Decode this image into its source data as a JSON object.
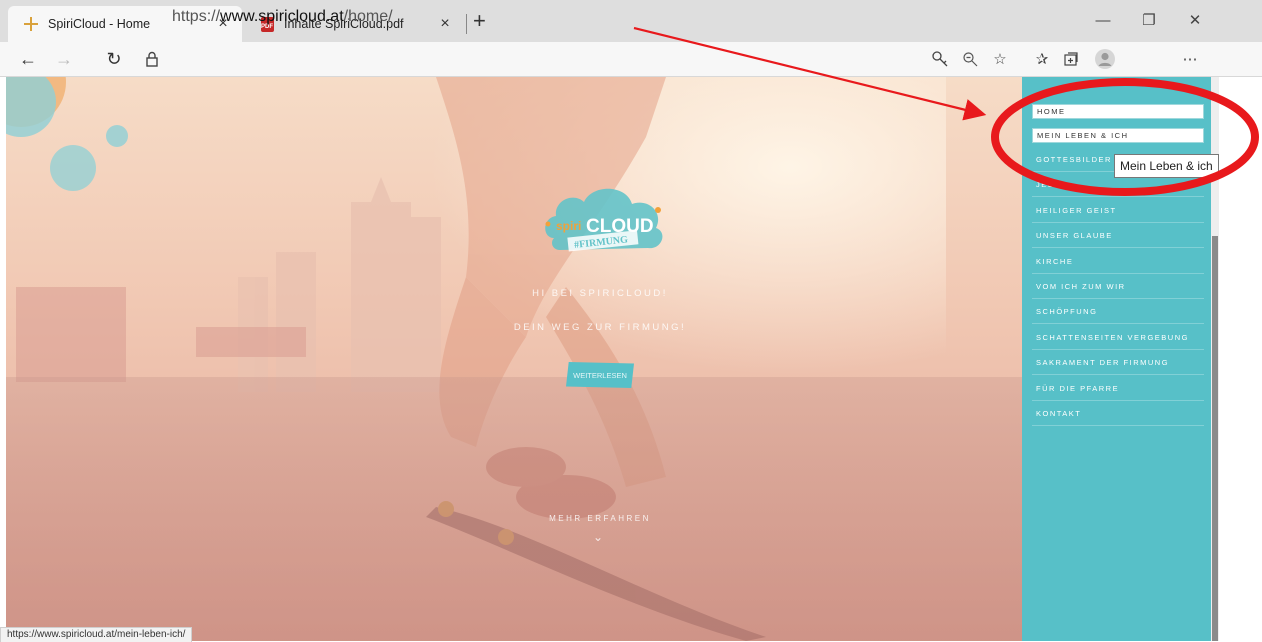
{
  "browser": {
    "tabs": [
      {
        "label": "SpiriCloud - Home",
        "active": true
      },
      {
        "label": "Inhalte SpiriCloud.pdf",
        "active": false
      }
    ],
    "close_glyph": "×",
    "new_tab_glyph": "+",
    "window": {
      "minimize": "—",
      "restore": "❐",
      "close": "✕"
    },
    "url": {
      "prefix": "https://",
      "domain": "www.spiricloud.at",
      "path": "/home/"
    },
    "nav": {
      "back": "←",
      "forward": "→",
      "reload": "↻"
    },
    "toolbar_icons": [
      "key-icon",
      "zoom-icon",
      "favorite-star-icon",
      "favorites-list-icon",
      "collections-icon",
      "profile-icon",
      "more-icon"
    ],
    "status_url": "https://www.spiricloud.at/mein-leben-ich/"
  },
  "hero": {
    "greeting": "HI BEI SPIRICLOUD!",
    "subtitle": "DEIN WEG ZUR FIRMUNG!",
    "read_more": "WEITERLESEN",
    "more": "MEHR ERFAHREN"
  },
  "logo": {
    "word": "CLOUD",
    "tag": "#FIRMUNG"
  },
  "menu": {
    "items": [
      {
        "label": "HOME"
      },
      {
        "label": "MEIN LEBEN & ICH"
      },
      {
        "label": "GOTTESBILDER"
      },
      {
        "label": "JESUS"
      },
      {
        "label": "HEILIGER GEIST"
      },
      {
        "label": "UNSER GLAUBE"
      },
      {
        "label": "KIRCHE"
      },
      {
        "label": "VOM ICH ZUM WIR"
      },
      {
        "label": "SCHÖPFUNG"
      },
      {
        "label": "SCHATTENSEITEN VERGEBUNG"
      },
      {
        "label": "SAKRAMENT DER FIRMUNG"
      },
      {
        "label": "FÜR DIE PFARRE"
      },
      {
        "label": "KONTAKT"
      }
    ],
    "tooltip": "Mein Leben & ich"
  },
  "colors": {
    "menu_bg": "#57c0c8",
    "annotation_red": "#e8191c",
    "logo_teal": "#63c3c9",
    "logo_orange": "#f2a13a"
  }
}
